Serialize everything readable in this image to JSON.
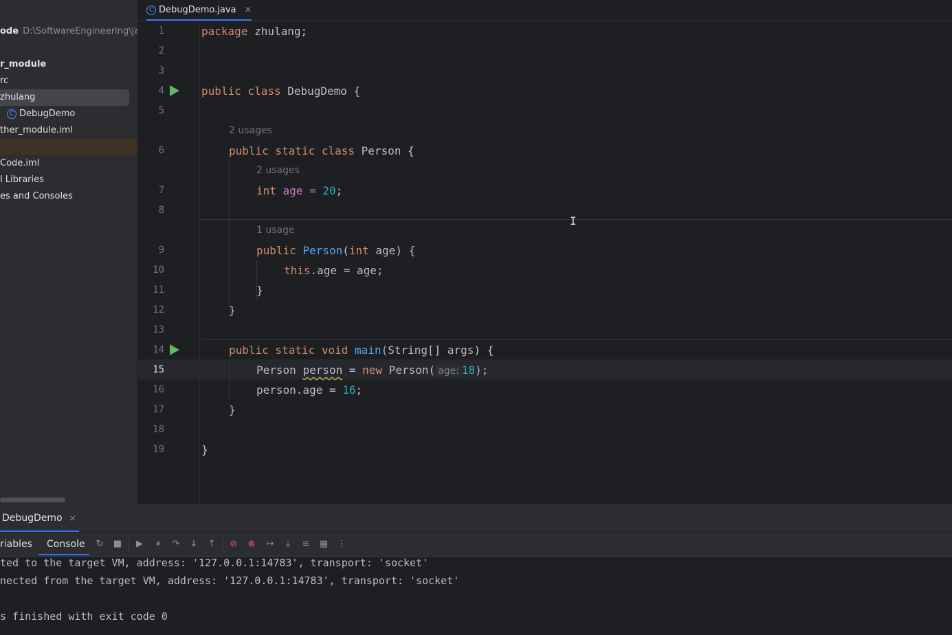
{
  "project_tree": {
    "root_name": "ode",
    "root_path": "D:\\SoftwareEngineering\\java",
    "items": [
      {
        "label": ""
      },
      {
        "label": "r_module"
      },
      {
        "label": "rc"
      },
      {
        "label": "zhulang"
      },
      {
        "label": "DebugDemo"
      },
      {
        "label": "ther_module.iml"
      },
      {
        "label": ""
      },
      {
        "label": "Code.iml"
      },
      {
        "label": "l Libraries"
      },
      {
        "label": "es and Consoles"
      }
    ]
  },
  "editor_tab": {
    "label": "DebugDemo.java",
    "close": "×"
  },
  "editor": {
    "line_numbers": [
      "1",
      "2",
      "3",
      "4",
      "5",
      "6",
      "7",
      "8",
      "9",
      "10",
      "11",
      "12",
      "13",
      "14",
      "15",
      "16",
      "17",
      "18",
      "19"
    ],
    "current_line": "15",
    "hints": {
      "h1": "2 usages",
      "h2": "2 usages",
      "h3": "1 usage"
    },
    "code": {
      "package_kw": "package",
      "package_name": " zhulang;",
      "public1": "public",
      "class1": " class",
      "class_name": " DebugDemo {",
      "public2": "public",
      "static2": " static",
      "class2": " class",
      "person_decl": " Person {",
      "int_kw": "int",
      "age_eq": " age = ",
      "age_val": "20",
      "semi1": ";",
      "public3": "public",
      "ctor_name": " Person",
      "ctor_open": "(",
      "ctor_int": "int",
      "ctor_rest": " age) {",
      "this_kw": "this",
      "this_rest": ".age = age;",
      "brace_inner": "}",
      "brace_class": "}",
      "public4": "public",
      "static4": " static",
      "void4": " void",
      "main_name": " main",
      "main_rest": "(String[] args) {",
      "l15_type": "Person ",
      "l15_var": "person",
      "l15_eq": " = ",
      "l15_new": "new",
      "l15_call": " Person(",
      "l15_inlay": "age:",
      "l15_num": "18",
      "l15_end": ");",
      "l16_a": "person.age = ",
      "l16_num": "16",
      "l16_end": ";",
      "brace_main": "}",
      "brace_outer": "}"
    }
  },
  "debug_panel": {
    "tab_label": "DebugDemo",
    "tab_close": "×",
    "variables_tab": "riables",
    "console_tab": "Console"
  },
  "console": {
    "lines": [
      "ted to the target VM, address: '127.0.0.1:14783', transport: 'socket'",
      "nected from the target VM, address: '127.0.0.1:14783', transport: 'socket'",
      "",
      "s finished with exit code 0"
    ]
  },
  "colors": {
    "accent": "#3574f0",
    "keyword": "#cf8e6d",
    "function": "#56a8f5",
    "number": "#2aacb8",
    "run_icon": "#5fb865"
  }
}
